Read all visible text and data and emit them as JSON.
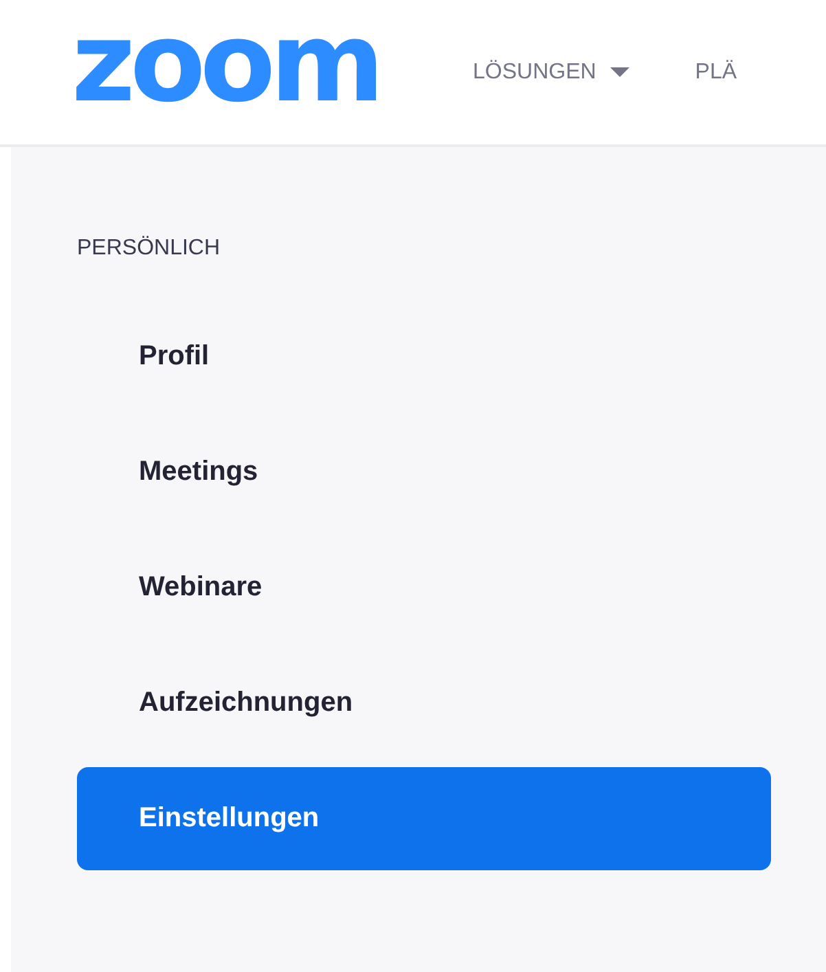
{
  "header": {
    "logo": "zoom",
    "nav": [
      {
        "label": "LÖSUNGEN",
        "dropdown": true
      },
      {
        "label": "PLÄ",
        "dropdown": false
      }
    ]
  },
  "sidebar": {
    "section": "PERSÖNLICH",
    "items": [
      {
        "label": "Profil",
        "selected": false
      },
      {
        "label": "Meetings",
        "selected": false
      },
      {
        "label": "Webinare",
        "selected": false
      },
      {
        "label": "Aufzeichnungen",
        "selected": false
      },
      {
        "label": "Einstellungen",
        "selected": true
      }
    ]
  }
}
